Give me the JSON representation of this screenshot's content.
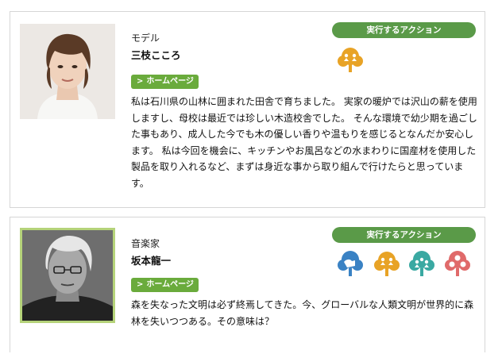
{
  "profiles": [
    {
      "role": "モデル",
      "name": "三枝こころ",
      "homepage_label": "ホームページ",
      "actions_title": "実行するアクション",
      "action_icons": [
        {
          "icon": "orange-tree-people-icon",
          "color": "#e8a326"
        }
      ],
      "description": "私は石川県の山林に囲まれた田舎で育ちました。 実家の暖炉では沢山の薪を使用しますし、母校は最近では珍しい木造校舎でした。 そんな環境で幼少期を過ごした事もあり、成人した今でも木の優しい香りや温もりを感じるとなんだか安心します。 私は今回を機会に、キッチンやお風呂などの水まわりに国産材を使用した製品を取り入れるなど、まずは身近な事から取り組んで行けたらと思っています。"
    },
    {
      "role": "音楽家",
      "name": "坂本龍一",
      "homepage_label": "ホームページ",
      "actions_title": "実行するアクション",
      "action_icons": [
        {
          "icon": "blue-tree-hand-icon",
          "color": "#3a82c4"
        },
        {
          "icon": "orange-tree-people-icon",
          "color": "#e8a326"
        },
        {
          "icon": "teal-tree-people-icon",
          "color": "#3aa9a2"
        },
        {
          "icon": "pink-tree-faces-icon",
          "color": "#e06a6a"
        }
      ],
      "description": "森を失なった文明は必ず終焉してきた。今、グローバルな人類文明が世界的に森林を失いつつある。その意味は？"
    }
  ],
  "colors": {
    "green_button": "#6aab3c",
    "action_pill": "#5a9a48",
    "photo_frame": "#b5d37a"
  }
}
